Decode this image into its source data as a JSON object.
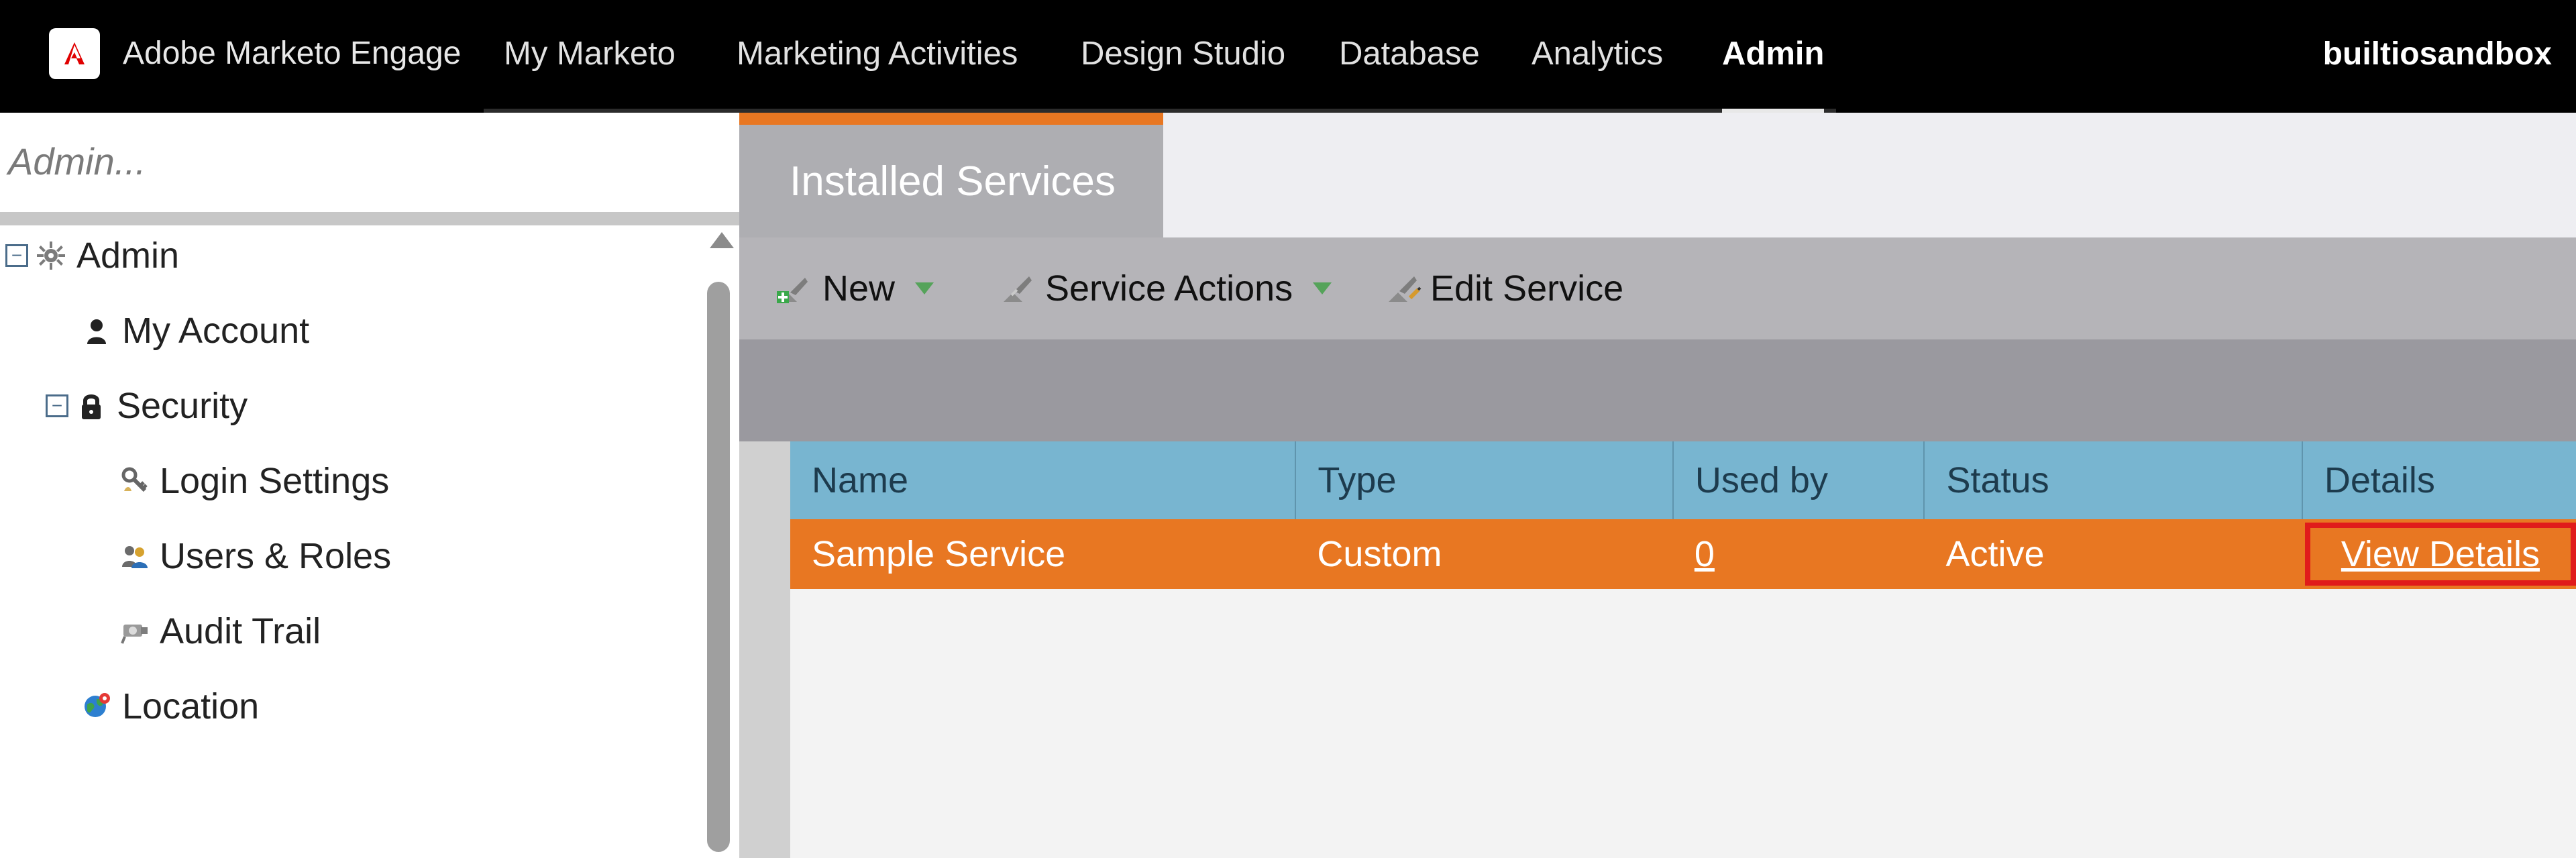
{
  "topbar": {
    "brand_name": "Adobe Marketo Engage",
    "nav": [
      "My Marketo",
      "Marketing Activities",
      "Design Studio",
      "Database",
      "Analytics",
      "Admin"
    ],
    "active_nav": "Admin",
    "account_name": "builtiosandbox"
  },
  "left": {
    "search_placeholder": "Admin...",
    "tree": {
      "admin": {
        "label": "Admin",
        "icon": "gear-icon"
      },
      "my_account": {
        "label": "My Account",
        "icon": "person-icon"
      },
      "security": {
        "label": "Security",
        "icon": "lock-icon"
      },
      "login_settings": {
        "label": "Login Settings",
        "icon": "key-icon"
      },
      "users_roles": {
        "label": "Users & Roles",
        "icon": "users-icon"
      },
      "audit_trail": {
        "label": "Audit Trail",
        "icon": "camera-icon"
      },
      "location": {
        "label": "Location",
        "icon": "globe-icon"
      }
    }
  },
  "main": {
    "tab_label": "Installed Services",
    "toolbar": {
      "new_label": "New",
      "service_actions_label": "Service Actions",
      "edit_service_label": "Edit Service"
    },
    "table": {
      "headers": [
        "Name",
        "Type",
        "Used by",
        "Status",
        "Details"
      ],
      "rows": [
        {
          "name": "Sample Service",
          "type": "Custom",
          "used_by": "0",
          "status": "Active",
          "details": "View Details"
        }
      ]
    }
  },
  "colors": {
    "orange": "#e87722",
    "blue": "#78b5d0",
    "red": "#e01b1b"
  }
}
